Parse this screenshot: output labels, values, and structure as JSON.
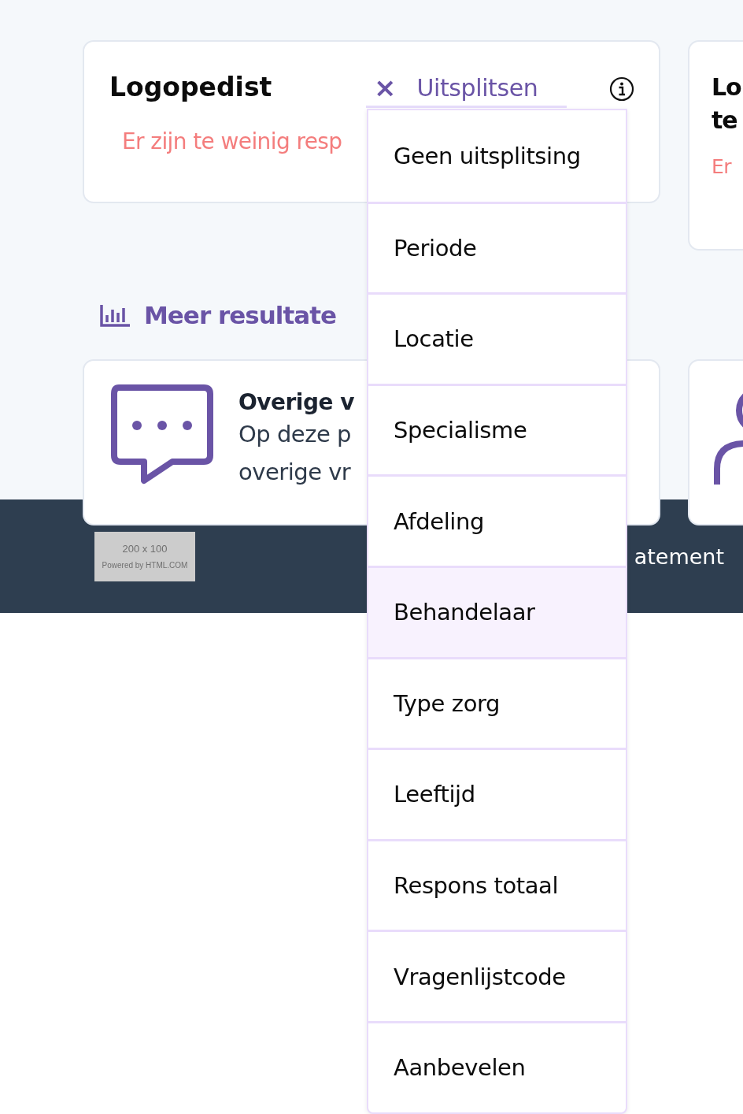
{
  "cards": [
    {
      "title_lines": [
        "Logopedist"
      ],
      "message": "Er zijn te weinig resp"
    },
    {
      "title_lines": [
        "Lo",
        "te"
      ],
      "message": "Er"
    }
  ],
  "breakdown": {
    "clear": "×",
    "label": "Uitsplitsen",
    "options": [
      {
        "label": "Geen uitsplitsing",
        "selected": false
      },
      {
        "label": "Periode",
        "selected": false
      },
      {
        "label": "Locatie",
        "selected": false
      },
      {
        "label": "Specialisme",
        "selected": false
      },
      {
        "label": "Afdeling",
        "selected": false
      },
      {
        "label": "Behandelaar",
        "selected": true
      },
      {
        "label": "Type zorg",
        "selected": false
      },
      {
        "label": "Leeftijd",
        "selected": false
      },
      {
        "label": "Respons totaal",
        "selected": false
      },
      {
        "label": "Vragenlijstcode",
        "selected": false
      },
      {
        "label": "Aanbevelen",
        "selected": false
      }
    ]
  },
  "more_results": {
    "heading": "Meer resultate",
    "cards": [
      {
        "kind": "comments",
        "title": "Overige v",
        "lines": [
          "Op deze p",
          "overige vr"
        ]
      },
      {
        "kind": "person"
      }
    ]
  },
  "footer": {
    "logo": {
      "size": "200 x 100",
      "credit": "Powered by HTML.COM"
    },
    "link": "atement"
  }
}
